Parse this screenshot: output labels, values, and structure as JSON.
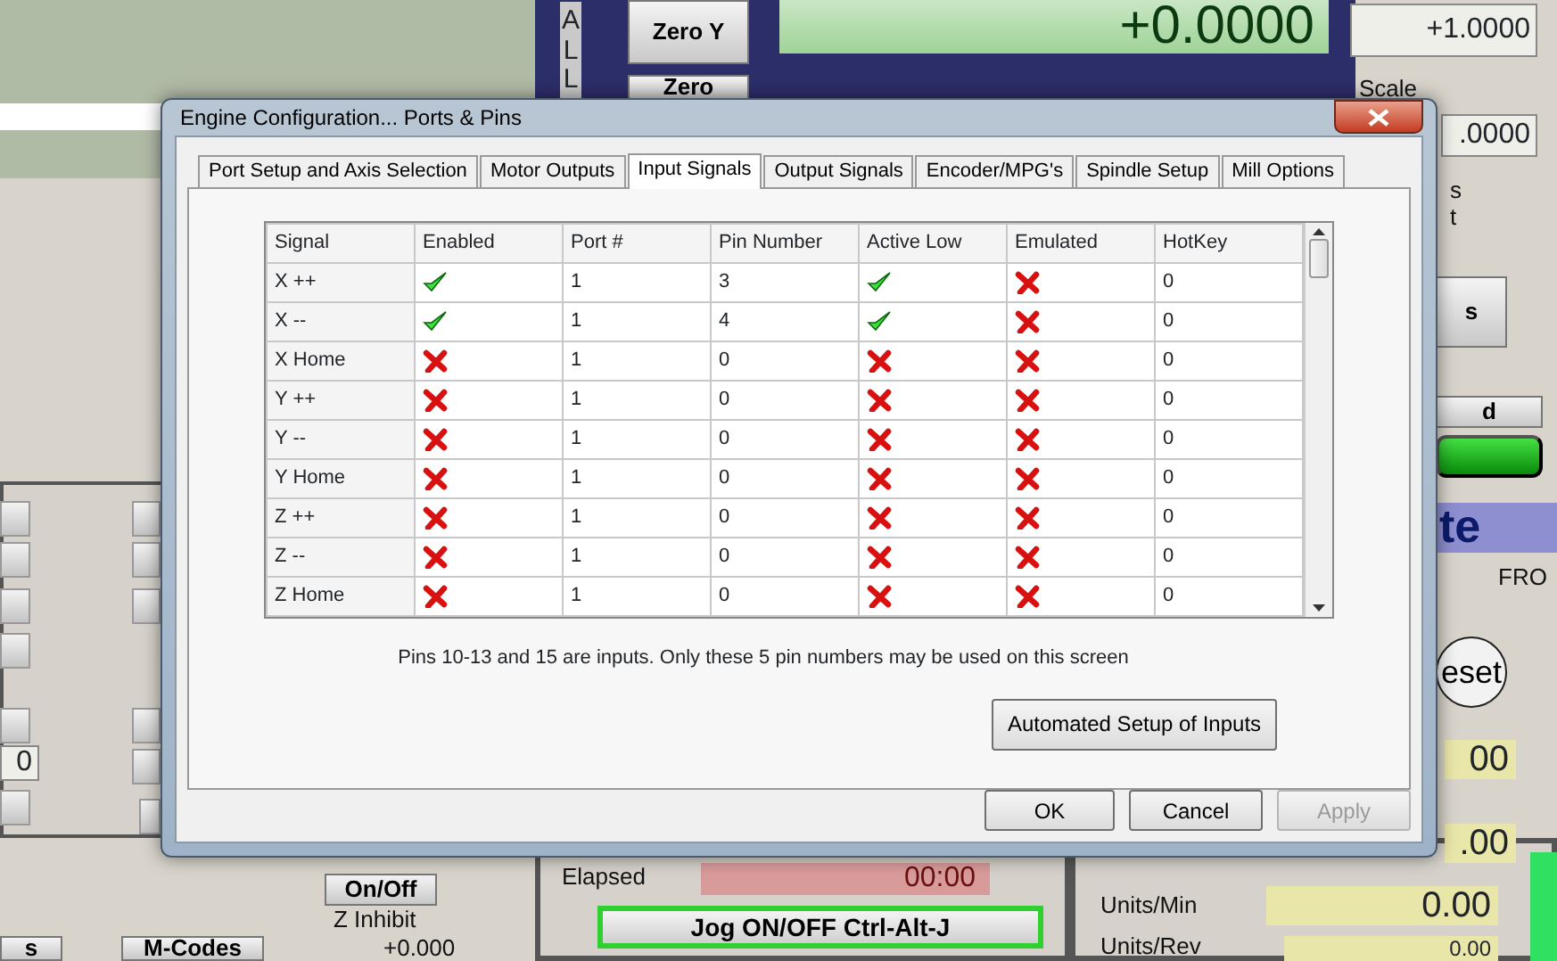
{
  "background": [
    {
      "kind": "vertical",
      "text": "ALL"
    },
    {
      "kind": "button",
      "text": "Zero Y"
    },
    {
      "kind": "dro",
      "text": "+0.0000"
    },
    {
      "kind": "box",
      "text": "+1.0000"
    },
    {
      "kind": "label",
      "text": "Scale"
    },
    {
      "kind": "box",
      "text": ".0000"
    },
    {
      "kind": "button",
      "text": "Zero"
    },
    {
      "kind": "label",
      "text": "s"
    },
    {
      "kind": "label",
      "text": "t"
    },
    {
      "kind": "button",
      "text": "s"
    },
    {
      "kind": "button",
      "text": "d"
    },
    {
      "kind": "green"
    },
    {
      "kind": "banner",
      "text": "te"
    },
    {
      "kind": "label",
      "text": "FRO"
    },
    {
      "kind": "round",
      "text": "eset"
    },
    {
      "kind": "yellow",
      "text": "00"
    },
    {
      "kind": "yellow",
      "text": ".00"
    },
    {
      "kind": "box",
      "text": "0"
    },
    {
      "kind": "label",
      "text": "Elapsed"
    },
    {
      "kind": "red",
      "text": "00:00"
    },
    {
      "kind": "button",
      "text": "On/Off"
    },
    {
      "kind": "label",
      "text": "Z Inhibit"
    },
    {
      "kind": "button",
      "text": "s"
    },
    {
      "kind": "button",
      "text": "M-Codes"
    },
    {
      "kind": "label",
      "text": "+0.000"
    },
    {
      "kind": "jog",
      "text": "Jog ON/OFF Ctrl-Alt-J"
    },
    {
      "kind": "label",
      "text": "Units/Min"
    },
    {
      "kind": "yellow",
      "text": "0.00"
    },
    {
      "kind": "label",
      "text": "Units/Rev"
    },
    {
      "kind": "yellow",
      "text": "0.00"
    },
    {
      "kind": "blank"
    },
    {
      "kind": "blank"
    },
    {
      "kind": "blank"
    },
    {
      "kind": "blank"
    },
    {
      "kind": "blank"
    },
    {
      "kind": "blank"
    },
    {
      "kind": "blank"
    },
    {
      "kind": "blank"
    },
    {
      "kind": "blank"
    },
    {
      "kind": "blank"
    },
    {
      "kind": "blank"
    },
    {
      "kind": "blank"
    }
  ],
  "dialog": {
    "title": "Engine Configuration... Ports & Pins",
    "tabs": [
      {
        "label": "Port Setup and Axis Selection",
        "selected": false
      },
      {
        "label": "Motor Outputs",
        "selected": false
      },
      {
        "label": "Input Signals",
        "selected": true
      },
      {
        "label": "Output Signals",
        "selected": false
      },
      {
        "label": "Encoder/MPG's",
        "selected": false
      },
      {
        "label": "Spindle Setup",
        "selected": false
      },
      {
        "label": "Mill Options",
        "selected": false
      }
    ],
    "columns": [
      "Signal",
      "Enabled",
      "Port #",
      "Pin Number",
      "Active Low",
      "Emulated",
      "HotKey"
    ],
    "rows": [
      {
        "signal": "X ++",
        "enabled": true,
        "port": "1",
        "pin": "3",
        "active_low": true,
        "emulated": false,
        "hotkey": "0"
      },
      {
        "signal": "X --",
        "enabled": true,
        "port": "1",
        "pin": "4",
        "active_low": true,
        "emulated": false,
        "hotkey": "0"
      },
      {
        "signal": "X Home",
        "enabled": false,
        "port": "1",
        "pin": "0",
        "active_low": false,
        "emulated": false,
        "hotkey": "0"
      },
      {
        "signal": "Y ++",
        "enabled": false,
        "port": "1",
        "pin": "0",
        "active_low": false,
        "emulated": false,
        "hotkey": "0"
      },
      {
        "signal": "Y --",
        "enabled": false,
        "port": "1",
        "pin": "0",
        "active_low": false,
        "emulated": false,
        "hotkey": "0"
      },
      {
        "signal": "Y Home",
        "enabled": false,
        "port": "1",
        "pin": "0",
        "active_low": false,
        "emulated": false,
        "hotkey": "0"
      },
      {
        "signal": "Z ++",
        "enabled": false,
        "port": "1",
        "pin": "0",
        "active_low": false,
        "emulated": false,
        "hotkey": "0"
      },
      {
        "signal": "Z --",
        "enabled": false,
        "port": "1",
        "pin": "0",
        "active_low": false,
        "emulated": false,
        "hotkey": "0"
      },
      {
        "signal": "Z Home",
        "enabled": false,
        "port": "1",
        "pin": "0",
        "active_low": false,
        "emulated": false,
        "hotkey": "0"
      }
    ],
    "note": "Pins 10-13 and 15 are inputs. Only these 5 pin numbers may be used on this screen",
    "automated_button": "Automated Setup of Inputs",
    "buttons": [
      {
        "label": "OK",
        "disabled": false
      },
      {
        "label": "Cancel",
        "disabled": false
      },
      {
        "label": "Apply",
        "disabled": true
      }
    ]
  }
}
